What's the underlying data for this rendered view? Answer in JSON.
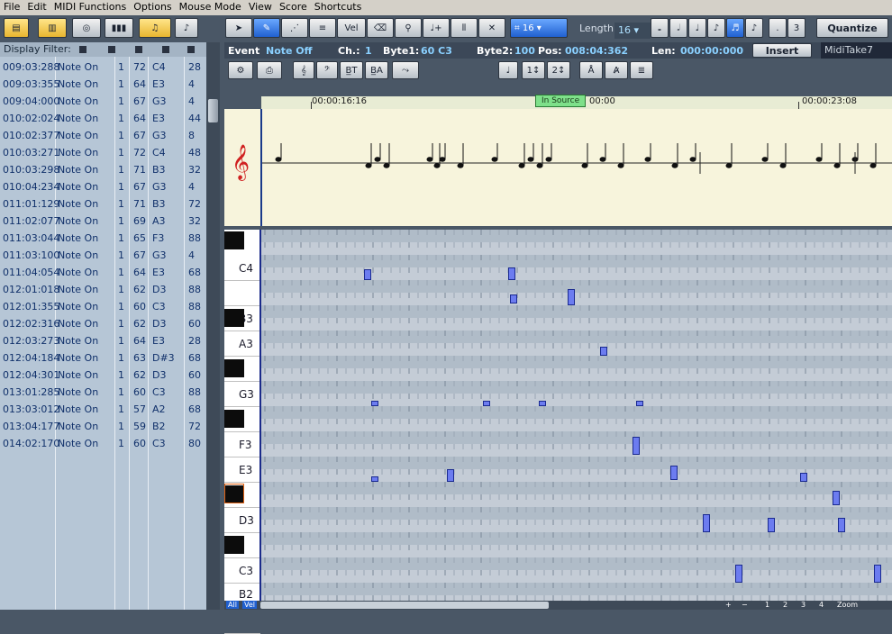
{
  "menu": [
    "File",
    "Edit",
    "MIDI Functions",
    "Options",
    "Mouse Mode",
    "View",
    "Score",
    "Shortcuts"
  ],
  "toolbar": {
    "snap_value": "16",
    "length_label": "Length:",
    "length_value": "16",
    "triplet": "3",
    "vel_label": "Vel",
    "quantize_label": "Quantize"
  },
  "filter": {
    "label": "Display Filter:"
  },
  "event_info": {
    "event_label": "Event",
    "event_value": "Note Off",
    "ch_label": "Ch.:",
    "ch_value": "1",
    "byte1_label": "Byte1:",
    "byte1_value": "60 C3",
    "byte2_label": "Byte2:",
    "byte2_value": "100",
    "pos_label": "Pos:",
    "pos_value": "008:04:362",
    "len_label": "Len:",
    "len_value": "000:00:000",
    "insert_label": "Insert",
    "take_name": "MidiTake7"
  },
  "ruler": {
    "marker1": "00:00:16:16",
    "source_label": "In Source",
    "marker2": "00:00",
    "marker3": "00:00:23:08"
  },
  "events": [
    {
      "pos": "009:03:288",
      "type": "Note On",
      "ch": "1",
      "b1": "72",
      "note": "C4",
      "vel": "28"
    },
    {
      "pos": "009:03:355",
      "type": "Note On",
      "ch": "1",
      "b1": "64",
      "note": "E3",
      "vel": "4"
    },
    {
      "pos": "009:04:000",
      "type": "Note On",
      "ch": "1",
      "b1": "67",
      "note": "G3",
      "vel": "4"
    },
    {
      "pos": "010:02:024",
      "type": "Note On",
      "ch": "1",
      "b1": "64",
      "note": "E3",
      "vel": "44"
    },
    {
      "pos": "010:02:377",
      "type": "Note On",
      "ch": "1",
      "b1": "67",
      "note": "G3",
      "vel": "8"
    },
    {
      "pos": "010:03:271",
      "type": "Note On",
      "ch": "1",
      "b1": "72",
      "note": "C4",
      "vel": "48"
    },
    {
      "pos": "010:03:298",
      "type": "Note On",
      "ch": "1",
      "b1": "71",
      "note": "B3",
      "vel": "32"
    },
    {
      "pos": "010:04:234",
      "type": "Note On",
      "ch": "1",
      "b1": "67",
      "note": "G3",
      "vel": "4"
    },
    {
      "pos": "011:01:129",
      "type": "Note On",
      "ch": "1",
      "b1": "71",
      "note": "B3",
      "vel": "72"
    },
    {
      "pos": "011:02:077",
      "type": "Note On",
      "ch": "1",
      "b1": "69",
      "note": "A3",
      "vel": "32"
    },
    {
      "pos": "011:03:044",
      "type": "Note On",
      "ch": "1",
      "b1": "65",
      "note": "F3",
      "vel": "88"
    },
    {
      "pos": "011:03:100",
      "type": "Note On",
      "ch": "1",
      "b1": "67",
      "note": "G3",
      "vel": "4"
    },
    {
      "pos": "011:04:054",
      "type": "Note On",
      "ch": "1",
      "b1": "64",
      "note": "E3",
      "vel": "68"
    },
    {
      "pos": "012:01:018",
      "type": "Note On",
      "ch": "1",
      "b1": "62",
      "note": "D3",
      "vel": "88"
    },
    {
      "pos": "012:01:355",
      "type": "Note On",
      "ch": "1",
      "b1": "60",
      "note": "C3",
      "vel": "88"
    },
    {
      "pos": "012:02:316",
      "type": "Note On",
      "ch": "1",
      "b1": "62",
      "note": "D3",
      "vel": "60"
    },
    {
      "pos": "012:03:273",
      "type": "Note On",
      "ch": "1",
      "b1": "64",
      "note": "E3",
      "vel": "28"
    },
    {
      "pos": "012:04:184",
      "type": "Note On",
      "ch": "1",
      "b1": "63",
      "note": "D#3",
      "vel": "68"
    },
    {
      "pos": "012:04:301",
      "type": "Note On",
      "ch": "1",
      "b1": "62",
      "note": "D3",
      "vel": "60"
    },
    {
      "pos": "013:01:285",
      "type": "Note On",
      "ch": "1",
      "b1": "60",
      "note": "C3",
      "vel": "88"
    },
    {
      "pos": "013:03:012",
      "type": "Note On",
      "ch": "1",
      "b1": "57",
      "note": "A2",
      "vel": "68"
    },
    {
      "pos": "013:04:177",
      "type": "Note On",
      "ch": "1",
      "b1": "59",
      "note": "B2",
      "vel": "72"
    },
    {
      "pos": "014:02:170",
      "type": "Note On",
      "ch": "1",
      "b1": "60",
      "note": "C3",
      "vel": "80"
    }
  ],
  "piano_labels": [
    "C4",
    "B3",
    "A3",
    "G3",
    "F3",
    "E3",
    "D3",
    "C3",
    "B2"
  ],
  "bottom": {
    "all": "All",
    "vel": "Vel",
    "zoom": "Zoom",
    "pages": [
      "1",
      "2",
      "3",
      "4"
    ]
  }
}
